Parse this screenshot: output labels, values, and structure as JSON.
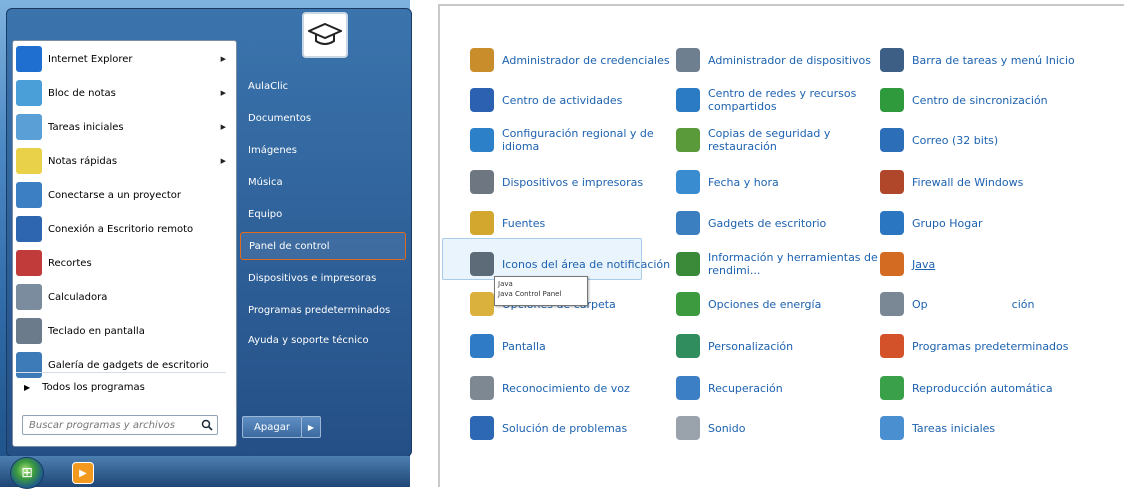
{
  "start_menu": {
    "programs": [
      {
        "label": "Internet Explorer",
        "icon": "internet-explorer-icon",
        "color": "#1f6fd0",
        "arrow": true
      },
      {
        "label": "Bloc de notas",
        "icon": "notepad-icon",
        "color": "#4b9fd8",
        "arrow": true
      },
      {
        "label": "Tareas iniciales",
        "icon": "getting-started-icon",
        "color": "#5aa0d6",
        "arrow": true
      },
      {
        "label": "Notas rápidas",
        "icon": "sticky-notes-icon",
        "color": "#e9d24a",
        "arrow": true
      },
      {
        "label": "Conectarse a un proyector",
        "icon": "projector-icon",
        "color": "#3c7fc3",
        "arrow": false
      },
      {
        "label": "Conexión a Escritorio remoto",
        "icon": "remote-desktop-icon",
        "color": "#2e66b0",
        "arrow": false
      },
      {
        "label": "Recortes",
        "icon": "snipping-tool-icon",
        "color": "#c23b3b",
        "arrow": false
      },
      {
        "label": "Calculadora",
        "icon": "calculator-icon",
        "color": "#7a8c9e",
        "arrow": false
      },
      {
        "label": "Teclado en pantalla",
        "icon": "keyboard-icon",
        "color": "#6b7b8c",
        "arrow": false
      },
      {
        "label": "Galería de gadgets de escritorio",
        "icon": "gadgets-icon",
        "color": "#3d7ab8",
        "arrow": false
      }
    ],
    "all_programs": "Todos los programas",
    "search_placeholder": "Buscar programas y archivos",
    "right_items": [
      "AulaClic",
      "Documentos",
      "Imágenes",
      "Música",
      "Equipo",
      "Panel de control",
      "Dispositivos e impresoras",
      "Programas predeterminados",
      "Ayuda y soporte técnico"
    ],
    "highlighted_item": "Panel de control",
    "shutdown_label": "Apagar"
  },
  "control_panel": {
    "items": [
      {
        "label": "Administrador de credenciales",
        "icon": "credential-manager-icon",
        "color": "#c98d2b"
      },
      {
        "label": "Administrador de dispositivos",
        "icon": "device-manager-icon",
        "color": "#6e7f90"
      },
      {
        "label": "Barra de tareas y menú Inicio",
        "icon": "taskbar-icon",
        "color": "#3d5f86"
      },
      {
        "label": "Centro de actividades",
        "icon": "action-center-flag-icon",
        "color": "#2c61b2"
      },
      {
        "label": "Centro de redes y recursos compartidos",
        "icon": "network-center-icon",
        "color": "#2b7bc4"
      },
      {
        "label": "Centro de sincronización",
        "icon": "sync-center-icon",
        "color": "#2f9a3c"
      },
      {
        "label": "Configuración regional y de idioma",
        "icon": "region-language-icon",
        "color": "#2b80c8"
      },
      {
        "label": "Copias de seguridad y restauración",
        "icon": "backup-restore-icon",
        "color": "#5a9a3a"
      },
      {
        "label": "Correo (32 bits)",
        "icon": "mail-icon",
        "color": "#2c6fb8"
      },
      {
        "label": "Dispositivos e impresoras",
        "icon": "devices-printers-icon",
        "color": "#6d7681"
      },
      {
        "label": "Fecha y hora",
        "icon": "date-time-icon",
        "color": "#3a8cd0"
      },
      {
        "label": "Firewall de Windows",
        "icon": "firewall-icon",
        "color": "#b0462a"
      },
      {
        "label": "Fuentes",
        "icon": "fonts-icon",
        "color": "#d3a62d"
      },
      {
        "label": "Gadgets de escritorio",
        "icon": "desktop-gadgets-icon",
        "color": "#3b7fc0"
      },
      {
        "label": "Grupo Hogar",
        "icon": "homegroup-icon",
        "color": "#2a76c0"
      },
      {
        "label": "Iconos del área de notificación",
        "icon": "notification-icons-icon",
        "color": "#5d6a78"
      },
      {
        "label": "Información y herramientas de rendimi...",
        "icon": "performance-icon",
        "color": "#3a8a3a"
      },
      {
        "label": "Java",
        "icon": "java-icon",
        "color": "#d36b22"
      },
      {
        "label": "Opciones de carpeta",
        "icon": "folder-options-icon",
        "color": "#d9b13c"
      },
      {
        "label": "Opciones de energía",
        "icon": "power-options-icon",
        "color": "#3e9a3e"
      },
      {
        "label": "Op",
        "tail": "ción",
        "icon": "indexing-options-icon",
        "color": "#7a8794"
      },
      {
        "label": "Pantalla",
        "icon": "display-icon",
        "color": "#2f7bc6"
      },
      {
        "label": "Personalización",
        "icon": "personalization-icon",
        "color": "#2f8d5e"
      },
      {
        "label": "Programas predeterminados",
        "icon": "default-programs-icon",
        "color": "#d4522a"
      },
      {
        "label": "Reconocimiento de voz",
        "icon": "microphone-icon",
        "color": "#7d8893"
      },
      {
        "label": "Recuperación",
        "icon": "recovery-icon",
        "color": "#3d7fc4"
      },
      {
        "label": "Reproducción automática",
        "icon": "autoplay-icon",
        "color": "#3aa04a"
      },
      {
        "label": "Solución de problemas",
        "icon": "troubleshooting-icon",
        "color": "#2c68b4"
      },
      {
        "label": "Sonido",
        "icon": "sound-icon",
        "color": "#9aa3ab"
      },
      {
        "label": "Tareas iniciales",
        "icon": "getting-started-icon",
        "color": "#4a8fd0"
      }
    ],
    "tooltip": {
      "line1": "Java",
      "line2": "Java Control Panel"
    }
  }
}
